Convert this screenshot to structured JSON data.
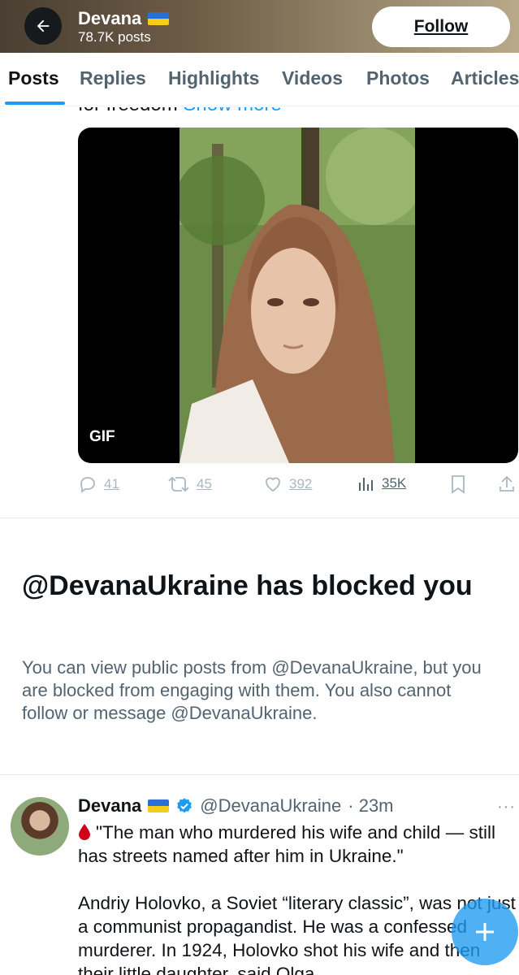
{
  "header": {
    "name": "Devana",
    "posts_count": "78.7K posts",
    "follow_label": "Follow"
  },
  "tabs": [
    "Posts",
    "Replies",
    "Highlights",
    "Videos",
    "Photos",
    "Articles"
  ],
  "active_tab": "Posts",
  "post1": {
    "clipped_text": "for freedom",
    "show_more": "Show more",
    "media_badge": "GIF",
    "replies": "41",
    "reposts": "45",
    "likes": "392",
    "views": "35K"
  },
  "blocked": {
    "title": "@DevanaUkraine has blocked you",
    "description": "You can view public posts from @DevanaUkraine, but you are blocked from engaging with them. You also cannot follow or message @DevanaUkraine."
  },
  "post2": {
    "name": "Devana",
    "handle": "@DevanaUkraine",
    "time": "· 23m",
    "more_icon": "more-icon",
    "line1": "\"The man who murdered his wife and child — still has streets named after him in Ukraine.\"",
    "line2": "Andriy Holovko, a Soviet “literary classic”, was not just a communist propagandist. He was a confessed murderer. In 1924, Holovko shot his wife and then their little daughter, said Olga..."
  },
  "colors": {
    "accent": "#1d9bf0",
    "text_primary": "#0f1419",
    "text_secondary": "#536471",
    "flag_blue": "#2a6fd6",
    "flag_yellow": "#f4cc1a"
  }
}
